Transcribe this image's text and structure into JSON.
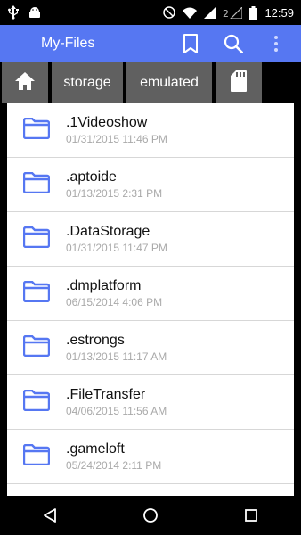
{
  "status_bar": {
    "left_icons": [
      "usb-icon",
      "android-icon"
    ],
    "right_icons": [
      "do-not-disturb-icon",
      "wifi-icon",
      "signal-icon",
      "sim-2-icon",
      "battery-icon"
    ],
    "time": "12:59"
  },
  "app_bar": {
    "title": "My-Files",
    "background": "#5677f2",
    "actions": [
      "bookmark-icon",
      "search-icon",
      "overflow-menu-icon"
    ]
  },
  "breadcrumb": {
    "items": [
      {
        "icon": "home-icon"
      },
      {
        "label": "storage"
      },
      {
        "label": "emulated"
      },
      {
        "icon": "sd-card-icon"
      }
    ]
  },
  "files": [
    {
      "name": ".1Videoshow",
      "date": "01/31/2015 11:46 PM"
    },
    {
      "name": ".aptoide",
      "date": "01/13/2015 2:31 PM"
    },
    {
      "name": ".DataStorage",
      "date": "01/31/2015 11:47 PM"
    },
    {
      "name": ".dmplatform",
      "date": "06/15/2014 4:06 PM"
    },
    {
      "name": ".estrongs",
      "date": "01/13/2015 11:17 AM"
    },
    {
      "name": ".FileTransfer",
      "date": "04/06/2015 11:56 AM"
    },
    {
      "name": ".gameloft",
      "date": "05/24/2014 2:11 PM"
    }
  ],
  "nav_bar": [
    "back-icon",
    "home-circle-icon",
    "recents-icon"
  ]
}
